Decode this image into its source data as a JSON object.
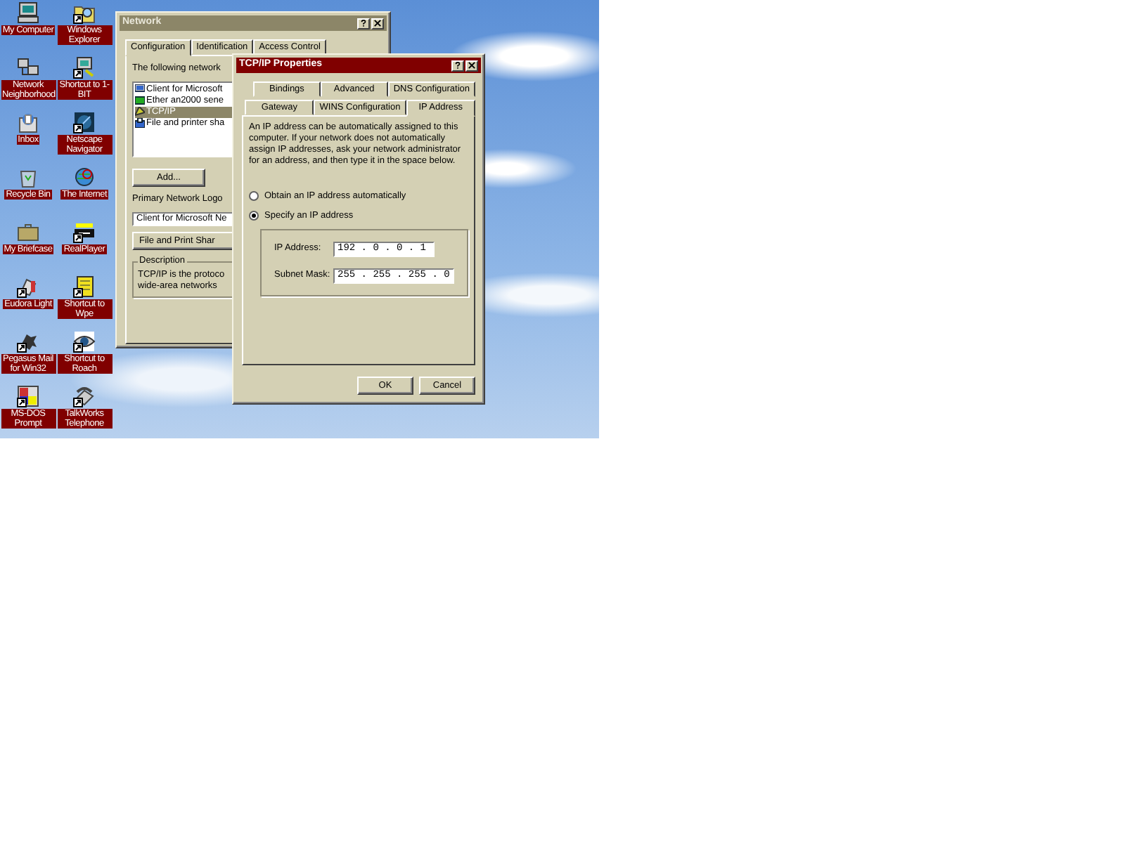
{
  "desktop_icons": [
    {
      "label": "My Computer",
      "shortcut": false
    },
    {
      "label": "Windows Explorer",
      "shortcut": true
    },
    {
      "label": "Network Neighborhood",
      "shortcut": false
    },
    {
      "label": "Shortcut to 1-BIT",
      "shortcut": true
    },
    {
      "label": "Inbox",
      "shortcut": false
    },
    {
      "label": "Netscape Navigator",
      "shortcut": true
    },
    {
      "label": "Recycle Bin",
      "shortcut": false
    },
    {
      "label": "The Internet",
      "shortcut": false
    },
    {
      "label": "My Briefcase",
      "shortcut": false
    },
    {
      "label": "RealPlayer",
      "shortcut": true
    },
    {
      "label": "Eudora Light",
      "shortcut": true
    },
    {
      "label": "Shortcut to Wpe",
      "shortcut": true
    },
    {
      "label": "Pegasus Mail for Win32",
      "shortcut": true
    },
    {
      "label": "Shortcut to Roach",
      "shortcut": true
    },
    {
      "label": "MS-DOS Prompt",
      "shortcut": true
    },
    {
      "label": "TalkWorks Telephone",
      "shortcut": true
    }
  ],
  "network_window": {
    "title": "Network",
    "active": false,
    "tabs": [
      {
        "label": "Configuration",
        "selected": true
      },
      {
        "label": "Identification",
        "selected": false
      },
      {
        "label": "Access Control",
        "selected": false
      }
    ],
    "components_label": "The following network",
    "components": [
      {
        "label": "Client for Microsoft",
        "selected": false
      },
      {
        "label": "Ether an2000 sene",
        "selected": false
      },
      {
        "label": "TCP/IP",
        "selected": true
      },
      {
        "label": "File and printer sha",
        "selected": false
      }
    ],
    "add_button": "Add...",
    "logon_label": "Primary Network Logo",
    "logon_value": "Client for Microsoft Ne",
    "sharing_button": "File and Print Shar",
    "description_title": "Description",
    "description_text": "TCP/IP is the protoco wide-area networks"
  },
  "tcpip_window": {
    "title": "TCP/IP Properties",
    "active": true,
    "tab_rows": [
      [
        {
          "label": "Bindings",
          "selected": false
        },
        {
          "label": "Advanced",
          "selected": false
        },
        {
          "label": "DNS Configuration",
          "selected": false
        }
      ],
      [
        {
          "label": "Gateway",
          "selected": false
        },
        {
          "label": "WINS Configuration",
          "selected": false
        },
        {
          "label": "IP Address",
          "selected": true
        }
      ]
    ],
    "intro": "An IP address can be automatically assigned to this computer. If your network does not automatically assign IP addresses, ask your network administrator for an address, and then type it in the space below.",
    "options": [
      {
        "label": "Obtain an IP address automatically",
        "selected": false
      },
      {
        "label": "Specify an IP address",
        "selected": true
      }
    ],
    "fields": [
      {
        "label": "IP Address:",
        "value": "192 . 0 . 0 . 1"
      },
      {
        "label": "Subnet Mask:",
        "value": "255 . 255 . 255 . 0"
      }
    ],
    "buttons": [
      "OK",
      "Cancel"
    ]
  }
}
